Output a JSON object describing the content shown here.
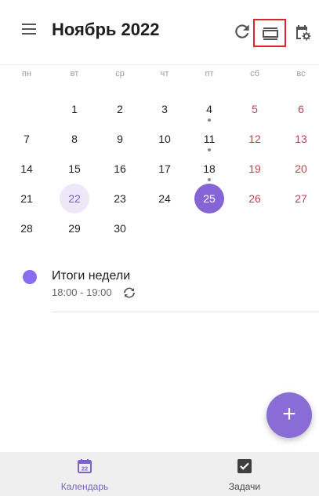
{
  "header": {
    "title": "Ноябрь 2022",
    "menu_icon": "hamburger-menu-icon",
    "refresh_icon": "refresh-icon",
    "view_icon": "view-mode-icon",
    "settings_icon": "calendar-settings-icon",
    "highlight_color": "#d9262f"
  },
  "weekdays": [
    "пн",
    "вт",
    "ср",
    "чт",
    "пт",
    "сб",
    "вс"
  ],
  "calendar": {
    "month": "Ноябрь",
    "year": "2022",
    "today": "22",
    "selected": "25",
    "days_with_events": [
      "4",
      "11",
      "18"
    ],
    "weeks": [
      [
        "",
        "1",
        "2",
        "3",
        "4",
        "5",
        "6"
      ],
      [
        "7",
        "8",
        "9",
        "10",
        "11",
        "12",
        "13"
      ],
      [
        "14",
        "15",
        "16",
        "17",
        "18",
        "19",
        "20"
      ],
      [
        "21",
        "22",
        "23",
        "24",
        "25",
        "26",
        "27"
      ],
      [
        "28",
        "29",
        "30",
        "",
        "",
        "",
        ""
      ]
    ]
  },
  "event": {
    "title": "Итоги недели",
    "time": "18:00 - 19:00",
    "color": "#8a6cf0",
    "repeat_icon": "repeat-icon"
  },
  "fab": {
    "label": "+",
    "icon": "add-icon"
  },
  "bottom_nav": {
    "calendar_label": "Календарь",
    "calendar_icon_day": "22",
    "tasks_label": "Задачи",
    "accent_color": "#7a62c9"
  },
  "colors": {
    "accent": "#8565d6",
    "weekend": "#c0424f",
    "today_bg": "#ede8f8"
  }
}
